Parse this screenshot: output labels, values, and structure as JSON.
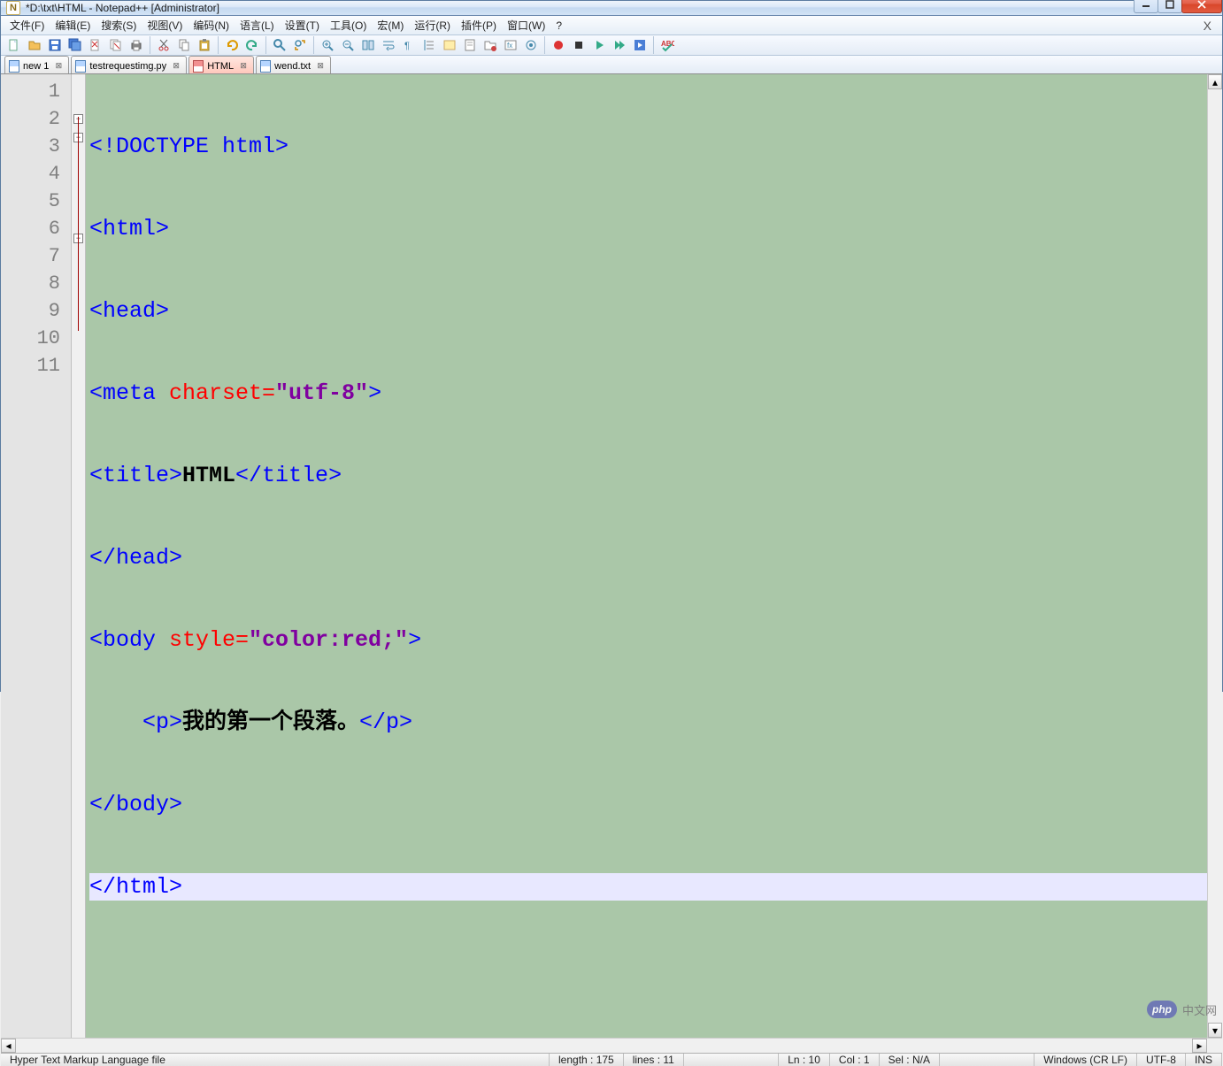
{
  "title": "*D:\\txt\\HTML - Notepad++ [Administrator]",
  "menus": [
    "文件(F)",
    "编辑(E)",
    "搜索(S)",
    "视图(V)",
    "编码(N)",
    "语言(L)",
    "设置(T)",
    "工具(O)",
    "宏(M)",
    "运行(R)",
    "插件(P)",
    "窗口(W)",
    "?"
  ],
  "tabs": [
    {
      "label": "new 1",
      "icon": "blue",
      "active": false,
      "unsaved": false
    },
    {
      "label": "testrequestimg.py",
      "icon": "blue",
      "active": false,
      "unsaved": false
    },
    {
      "label": "HTML",
      "icon": "red",
      "active": true,
      "unsaved": true
    },
    {
      "label": "wend.txt",
      "icon": "blue",
      "active": false,
      "unsaved": false
    }
  ],
  "lineNumbers": [
    "1",
    "2",
    "3",
    "4",
    "5",
    "6",
    "7",
    "8",
    "9",
    "10",
    "11"
  ],
  "code": {
    "l1": {
      "open": "<!DOCTYPE",
      "rest": " html",
      "close": ">"
    },
    "l2": {
      "tag": "<html>"
    },
    "l3": {
      "tag": "<head>"
    },
    "l4": {
      "open": "<meta ",
      "attr": "charset=",
      "val": "\"utf-8\"",
      "close": ">"
    },
    "l5": {
      "open": "<title>",
      "txt": "HTML",
      "close": "</title>"
    },
    "l6": {
      "tag": "</head>"
    },
    "l7": {
      "open": "<body ",
      "attr": "style=",
      "val": "\"color:red;\"",
      "close": ">"
    },
    "l8": {
      "indent": "    ",
      "open": "<p>",
      "txt": "我的第一个段落。",
      "close": "</p>"
    },
    "l9": {
      "tag": "</body>"
    },
    "l10": {
      "tag": "</html>"
    }
  },
  "status": {
    "filetype": "Hyper Text Markup Language file",
    "length": "length : 175",
    "lines": "lines : 11",
    "ln": "Ln : 10",
    "col": "Col : 1",
    "sel": "Sel : N/A",
    "eol": "Windows (CR LF)",
    "encoding": "UTF-8",
    "ins": "INS"
  },
  "watermark": {
    "logo": "php",
    "text": "中文网"
  },
  "toolbarIcons": [
    "new-file",
    "open-file",
    "save",
    "save-all",
    "close",
    "close-all",
    "print",
    "",
    "cut",
    "copy",
    "paste",
    "",
    "undo",
    "redo",
    "",
    "find",
    "replace",
    "",
    "zoom-in",
    "zoom-out",
    "sync",
    "word-wrap",
    "show-all",
    "indent-guide",
    "lang",
    "folder",
    "doc-map",
    "func-list",
    "monitor",
    "",
    "record",
    "stop",
    "play",
    "play-multi",
    "save-macro",
    "",
    "spellcheck"
  ]
}
